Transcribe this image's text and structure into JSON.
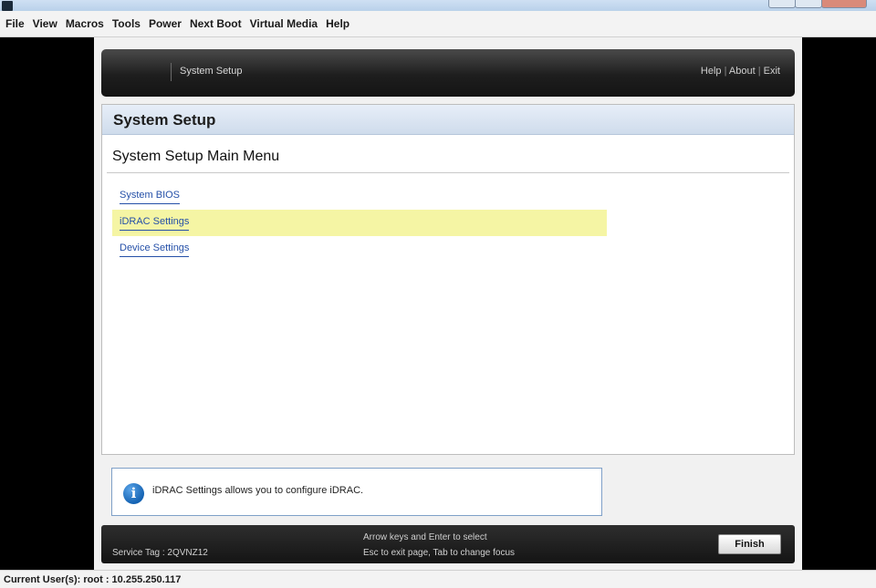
{
  "menubar": {
    "items": [
      "File",
      "View",
      "Macros",
      "Tools",
      "Power",
      "Next Boot",
      "Virtual Media",
      "Help"
    ]
  },
  "topbar": {
    "title": "System Setup",
    "links": [
      "Help",
      "About",
      "Exit"
    ],
    "separator": "|"
  },
  "panel": {
    "header": "System Setup",
    "heading": "System Setup Main Menu",
    "items": [
      {
        "label": "System BIOS",
        "selected": false
      },
      {
        "label": "iDRAC Settings",
        "selected": true
      },
      {
        "label": "Device Settings",
        "selected": false
      }
    ]
  },
  "info": {
    "icon": "info-icon",
    "text": "iDRAC Settings allows you to configure iDRAC."
  },
  "footer": {
    "service_tag": "Service Tag : 2QVNZ12",
    "hint_line1": "Arrow keys and Enter to select",
    "hint_line2": "Esc to exit page, Tab to change focus",
    "finish_label": "Finish"
  },
  "statusbar": {
    "text": "Current User(s): root : 10.255.250.117"
  },
  "colors": {
    "selected_row": "#f5f5a4",
    "link": "#2550a8",
    "panel_header": "#dbe6f3"
  }
}
